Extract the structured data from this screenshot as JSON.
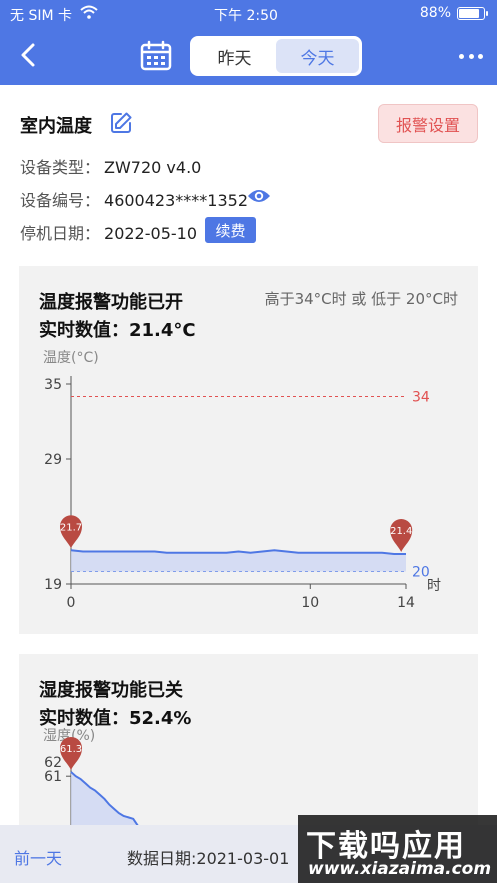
{
  "status_bar": {
    "carrier": "无 SIM 卡",
    "time": "下午 2:50",
    "battery": "88%",
    "battery_level": 0.88
  },
  "nav": {
    "tabs": [
      {
        "label": "昨天",
        "active": false
      },
      {
        "label": "今天",
        "active": true
      }
    ]
  },
  "device": {
    "name": "室内温度",
    "alarm_button": "报警设置",
    "type_label": "设备类型：",
    "type_value": "ZW720 v4.0",
    "id_label": "设备编号：",
    "id_value": "4600423****1352",
    "stop_label": "停机日期：",
    "stop_value": "2022-05-10",
    "renew_button": "续费"
  },
  "temp_card": {
    "title": "温度报警功能已开",
    "realtime_label": "实时数值：",
    "realtime_value": "21.4°C",
    "hint": "高于34°C时 或 低于 20°C时"
  },
  "humidity_card": {
    "title": "湿度报警功能已关",
    "realtime_label": "实时数值：",
    "realtime_value": "52.4%"
  },
  "bottom": {
    "prev_day": "前一天",
    "data_date": "数据日期:2021-03-01"
  },
  "watermark": {
    "line1": "下载吗应用",
    "line2": "www.xiazaima.com"
  },
  "colors": {
    "accent": "#4e77e4",
    "alarm": "#e15252",
    "marker": "#b94a42"
  },
  "chart_data": [
    {
      "type": "area",
      "ylabel": "温度(°C)",
      "xlabel": "时",
      "ylim": [
        19,
        35
      ],
      "xlim": [
        0,
        14
      ],
      "yticks": [
        19,
        29,
        35
      ],
      "xticks": [
        0,
        10,
        14
      ],
      "thresholds": [
        {
          "value": 34,
          "label": "34",
          "color": "#e15252"
        },
        {
          "value": 20,
          "label": "20",
          "color": "#4e77e4"
        }
      ],
      "markers": [
        {
          "x": 0,
          "value": 21.7,
          "label": "21.7"
        },
        {
          "x": 13.8,
          "value": 21.4,
          "label": "21.4"
        }
      ],
      "x": [
        0,
        0.5,
        1,
        1.5,
        2,
        2.5,
        3,
        3.5,
        4,
        4.5,
        5,
        5.5,
        6,
        6.5,
        7,
        7.5,
        8,
        8.5,
        9,
        9.5,
        10,
        10.5,
        11,
        11.5,
        12,
        12.5,
        13,
        13.5,
        14
      ],
      "values": [
        21.7,
        21.6,
        21.6,
        21.6,
        21.6,
        21.6,
        21.6,
        21.6,
        21.5,
        21.5,
        21.5,
        21.5,
        21.5,
        21.5,
        21.6,
        21.5,
        21.6,
        21.7,
        21.6,
        21.5,
        21.5,
        21.5,
        21.5,
        21.5,
        21.5,
        21.5,
        21.5,
        21.4,
        21.4
      ]
    },
    {
      "type": "area",
      "ylabel": "湿度(%)",
      "ylim": [
        52,
        62
      ],
      "yticks": [
        61,
        62
      ],
      "xlim": [
        0,
        14
      ],
      "markers": [
        {
          "x": 0,
          "value": 61.3,
          "label": "61.3"
        }
      ],
      "x": [
        0,
        0.2,
        0.4,
        0.6,
        0.8,
        1.0,
        1.2,
        1.4,
        1.6,
        1.8,
        2.0,
        2.2,
        2.4,
        2.6,
        2.8
      ],
      "values": [
        61.3,
        61.0,
        60.8,
        60.5,
        60.2,
        60.0,
        59.7,
        59.4,
        59.0,
        58.7,
        58.4,
        58.2,
        58.1,
        58.0,
        57.5
      ]
    }
  ]
}
